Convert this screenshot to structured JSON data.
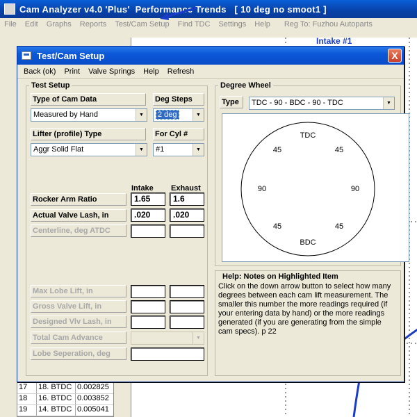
{
  "app": {
    "title": "Cam Analyzer v4.0 'Plus'  Performance Trends   [ 10 deg no smoot1 ]",
    "menu": [
      "File",
      "Edit",
      "Graphs",
      "Reports",
      "Test/Cam Setup",
      "Find TDC",
      "Settings",
      "Help"
    ],
    "reg_to": "Reg To: Fuzhou Autoparts",
    "graph_title": "Intake #1",
    "table_rows": [
      [
        "17",
        "18. BTDC",
        "0.002825"
      ],
      [
        "18",
        "16. BTDC",
        "0.003852"
      ],
      [
        "19",
        "14. BTDC",
        "0.005041"
      ]
    ]
  },
  "dialog": {
    "title": "Test/Cam Setup",
    "close_label": "X",
    "menu": [
      "Back (ok)",
      "Print",
      "Valve Springs",
      "Help",
      "Refresh"
    ],
    "test_setup": {
      "title": "Test Setup",
      "type_label": "Type of Cam Data",
      "type_value": "Measured by Hand",
      "deg_steps_label": "Deg Steps",
      "deg_steps_value": "2 deg",
      "lifter_label": "Lifter (profile) Type",
      "lifter_value": "Aggr Solid Flat",
      "cyl_label": "For Cyl #",
      "cyl_value": "#1",
      "intake_head": "Intake",
      "exhaust_head": "Exhaust",
      "rocker_label": "Rocker Arm Ratio",
      "rocker_intake": "1.65",
      "rocker_exhaust": "1.6",
      "lash_label": "Actual Valve Lash, in",
      "lash_intake": ".020",
      "lash_exhaust": ".020",
      "centerline_label": "Centerline, deg ATDC",
      "max_lobe_label": "Max Lobe Lift, in",
      "gross_lift_label": "Gross Valve Lift, in",
      "designed_lash_label": "Designed Vlv Lash, in",
      "total_advance_label": "Total Cam Advance",
      "lobe_sep_label": "Lobe Seperation, deg"
    },
    "degree_wheel": {
      "title": "Degree Wheel",
      "type_label": "Type",
      "type_value": "TDC - 90 - BDC - 90 - TDC",
      "labels": {
        "tdc": "TDC",
        "bdc": "BDC",
        "upper_left": "45",
        "upper_right": "45",
        "left": "90",
        "right": "90",
        "lower_left": "45",
        "lower_right": "45"
      }
    },
    "help": {
      "title": "Help:  Notes on Highlighted Item",
      "text": "Click on the down arrow button to select how many degrees between each cam lift measurement.  The smaller this number the more readings required (if your entering data by hand) or the more readings generated (if you are generating from the simple cam specs).  p 22"
    }
  },
  "colors": {
    "titlebar": "#0a4cc8",
    "accent": "#1a3cc8",
    "selection": "#316ac5",
    "close": "#c8402a"
  }
}
